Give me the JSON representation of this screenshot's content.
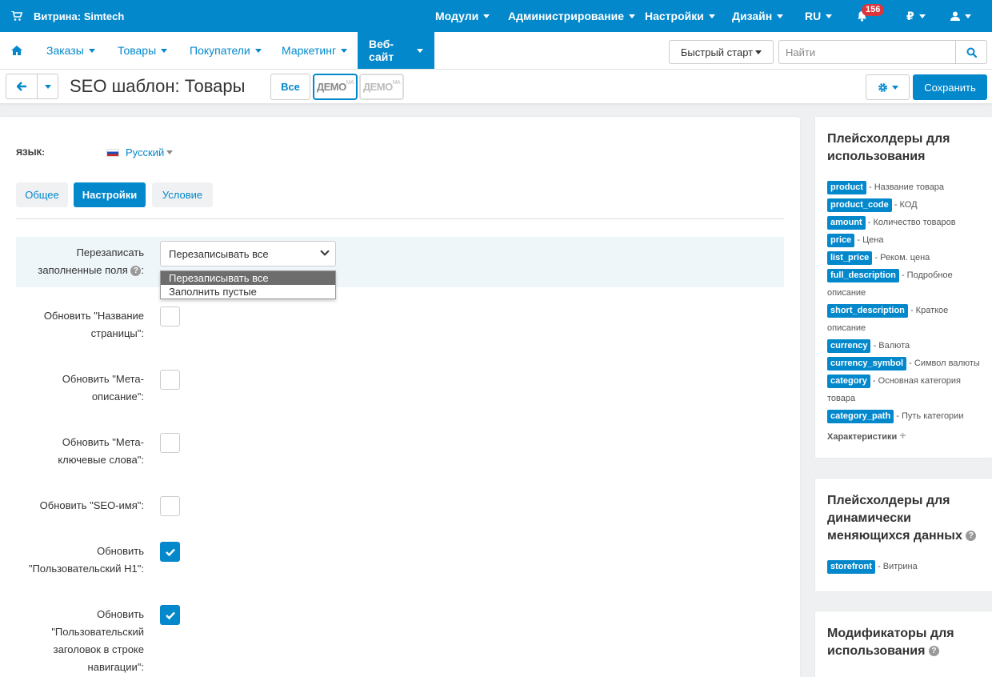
{
  "topbar": {
    "brand": "Витрина: Simtech",
    "menu": [
      "Модули",
      "Администрирование",
      "Настройки",
      "Дизайн",
      "RU"
    ],
    "notifications": "156",
    "currency": "₽",
    "icons": [
      "cart-icon",
      "bell-icon",
      "user-icon"
    ]
  },
  "nav": {
    "items": [
      "Заказы",
      "Товары",
      "Покупатели",
      "Маркетинг",
      "Веб-сайт"
    ],
    "active": "Веб-сайт",
    "quick_start": "Быстрый старт",
    "search_placeholder": "Найти"
  },
  "titlebar": {
    "title": "SEO шаблон: Товары",
    "all_btn": "Все",
    "demo1": "ДЕМО",
    "demo2": "ДЕМО",
    "demo_sup": "MA",
    "save": "Сохранить"
  },
  "form": {
    "language_label": "ЯЗЫК:",
    "language": "Русский",
    "tabs": [
      "Общее",
      "Настройки",
      "Условие"
    ],
    "active_tab": "Настройки",
    "overwrite_label_1": "Перезаписать",
    "overwrite_label_2": "заполненные поля",
    "overwrite_value": "Перезаписывать все",
    "options": [
      "Перезаписывать все",
      "Заполнить пустые"
    ],
    "fields": [
      {
        "l1": "Обновить \"Название",
        "l2": "страницы\":",
        "checked": false
      },
      {
        "l1": "Обновить \"Мета-",
        "l2": "описание\":",
        "checked": false
      },
      {
        "l1": "Обновить \"Мета-",
        "l2": "ключевые слова\":",
        "checked": false
      },
      {
        "l1": "Обновить \"SEO-имя\":",
        "checked": false
      },
      {
        "l1": "Обновить",
        "l2": "\"Пользовательский H1\":",
        "checked": true
      },
      {
        "l1": "Обновить",
        "l2": "\"Пользовательский",
        "l3": "заголовок в строке",
        "l4": "навигации\":",
        "checked": true
      }
    ]
  },
  "sidebar": {
    "box1_title_1": "Плейсхолдеры для",
    "box1_title_2": "использования",
    "placeholders": [
      {
        "tag": "product",
        "desc": " - Название товара"
      },
      {
        "tag": "product_code",
        "desc": " - КОД"
      },
      {
        "tag": "amount",
        "desc": " - Количество товаров"
      },
      {
        "tag": "price",
        "desc": " - Цена"
      },
      {
        "tag": "list_price",
        "desc": " - Реком. цена"
      },
      {
        "tag": "full_description",
        "desc": " - Подробное",
        "desc2": "описание"
      },
      {
        "tag": "short_description",
        "desc": " - Краткое",
        "desc2": "описание"
      },
      {
        "tag": "currency",
        "desc": " - Валюта"
      },
      {
        "tag": "currency_symbol",
        "desc": " - Символ валюты"
      },
      {
        "tag": "category",
        "desc": " - Основная категория",
        "desc2": "товара"
      },
      {
        "tag": "category_path",
        "desc": " - Путь категории"
      }
    ],
    "characteristics": "Характеристики",
    "box2_title_1": "Плейсхолдеры для",
    "box2_title_2": "динамически",
    "box2_title_3": "меняющихся данных",
    "dyn_tag": "storefront",
    "dyn_desc": " - Витрина",
    "box3_title_1": "Модификаторы для",
    "box3_title_2": "использования"
  },
  "colors": {
    "primary": "#0388cc",
    "badge": "#d9363e"
  }
}
